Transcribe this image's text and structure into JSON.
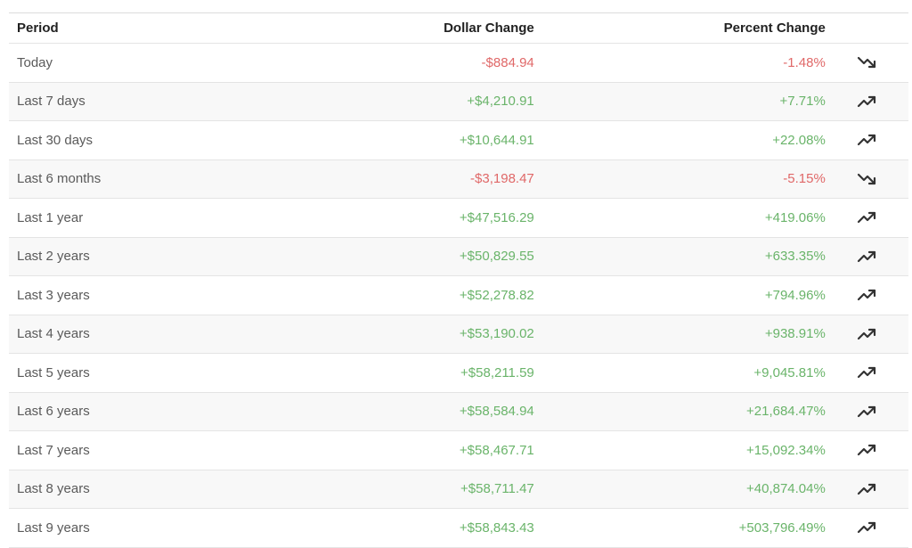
{
  "headers": {
    "period": "Period",
    "dollar": "Dollar Change",
    "percent": "Percent Change"
  },
  "colors": {
    "positive": "#6ab46a",
    "negative": "#e06868"
  },
  "rows": [
    {
      "period": "Today",
      "dollar": "-$884.94",
      "percent": "-1.48%",
      "trend": "trending-down-icon"
    },
    {
      "period": "Last 7 days",
      "dollar": "+$4,210.91",
      "percent": "+7.71%",
      "trend": "trending-up-icon"
    },
    {
      "period": "Last 30 days",
      "dollar": "+$10,644.91",
      "percent": "+22.08%",
      "trend": "trending-up-icon"
    },
    {
      "period": "Last 6 months",
      "dollar": "-$3,198.47",
      "percent": "-5.15%",
      "trend": "trending-down-icon"
    },
    {
      "period": "Last 1 year",
      "dollar": "+$47,516.29",
      "percent": "+419.06%",
      "trend": "trending-up-icon"
    },
    {
      "period": "Last 2 years",
      "dollar": "+$50,829.55",
      "percent": "+633.35%",
      "trend": "trending-up-icon"
    },
    {
      "period": "Last 3 years",
      "dollar": "+$52,278.82",
      "percent": "+794.96%",
      "trend": "trending-up-icon"
    },
    {
      "period": "Last 4 years",
      "dollar": "+$53,190.02",
      "percent": "+938.91%",
      "trend": "trending-up-icon"
    },
    {
      "period": "Last 5 years",
      "dollar": "+$58,211.59",
      "percent": "+9,045.81%",
      "trend": "trending-up-icon"
    },
    {
      "period": "Last 6 years",
      "dollar": "+$58,584.94",
      "percent": "+21,684.47%",
      "trend": "trending-up-icon"
    },
    {
      "period": "Last 7 years",
      "dollar": "+$58,467.71",
      "percent": "+15,092.34%",
      "trend": "trending-up-icon"
    },
    {
      "period": "Last 8 years",
      "dollar": "+$58,711.47",
      "percent": "+40,874.04%",
      "trend": "trending-up-icon"
    },
    {
      "period": "Last 9 years",
      "dollar": "+$58,843.43",
      "percent": "+503,796.49%",
      "trend": "trending-up-icon"
    }
  ]
}
